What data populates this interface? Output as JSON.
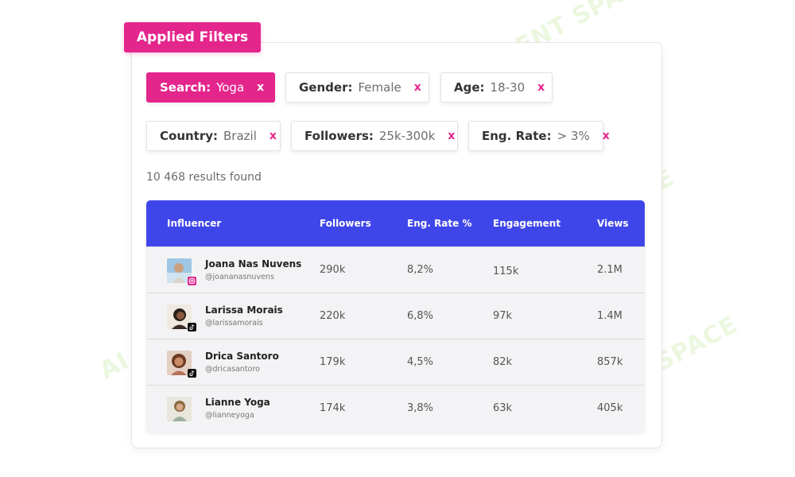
{
  "watermark": "AI TALENT SPACE",
  "header": {
    "title": "Applied Filters"
  },
  "filters": [
    {
      "key": "Search:",
      "value": "Yoga",
      "remove": "x",
      "active": true
    },
    {
      "key": "Gender:",
      "value": "Female",
      "remove": "x",
      "active": false
    },
    {
      "key": "Age:",
      "value": "18-30",
      "remove": "x",
      "active": false
    },
    {
      "key": "Country:",
      "value": "Brazil",
      "remove": "x",
      "active": false
    },
    {
      "key": "Followers:",
      "value": "25k-300k",
      "remove": "x",
      "active": false
    },
    {
      "key": "Eng. Rate:",
      "value": "> 3%",
      "remove": "x",
      "active": false
    }
  ],
  "results": {
    "count_text": "10 468 results found"
  },
  "table": {
    "columns": [
      "Influencer",
      "Followers",
      "Eng. Rate %",
      "Engagement",
      "Views"
    ],
    "rows": [
      {
        "name": "Joana Nas Nuvens",
        "handle": "@joananasnuvens",
        "platform": "instagram-icon",
        "followers": "290k",
        "eng_rate": "8,2%",
        "engagement": "115k",
        "views": "2.1M"
      },
      {
        "name": "Larissa Morais",
        "handle": "@larissamorais",
        "platform": "tiktok-icon",
        "followers": "220k",
        "eng_rate": "6,8%",
        "engagement": "97k",
        "views": "1.4M"
      },
      {
        "name": "Drica Santoro",
        "handle": "@dricasantoro",
        "platform": "tiktok-icon",
        "followers": "179k",
        "eng_rate": "4,5%",
        "engagement": "82k",
        "views": "857k"
      },
      {
        "name": "Lianne Yoga",
        "handle": "@lianneyoga",
        "platform": "none",
        "followers": "174k",
        "eng_rate": "3,8%",
        "engagement": "63k",
        "views": "405k"
      }
    ]
  },
  "colors": {
    "accent": "#e4258c",
    "table_header": "#3f46e9",
    "row_bg": "#f3f3f5",
    "watermark": "#d3efba"
  }
}
